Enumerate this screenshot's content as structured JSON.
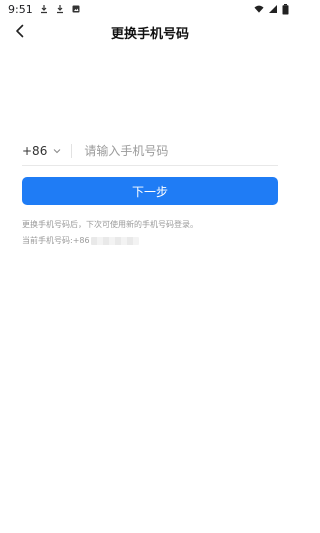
{
  "status_bar": {
    "time": "9:51",
    "left_icons": [
      "download-icon",
      "download-icon",
      "notification-image-icon"
    ],
    "right_icons": [
      "wifi-icon",
      "signal-icon",
      "battery-icon"
    ]
  },
  "header": {
    "title": "更换手机号码",
    "back_icon": "chevron-left-icon"
  },
  "phone": {
    "country_code": "+86",
    "placeholder": "请输入手机号码",
    "value": ""
  },
  "next_button": {
    "label": "下一步",
    "color": "#1f7cf5"
  },
  "info": {
    "line1": "更换手机号码后，下次可使用新的手机号码登录。",
    "line2_prefix": "当前手机号码:+86"
  }
}
